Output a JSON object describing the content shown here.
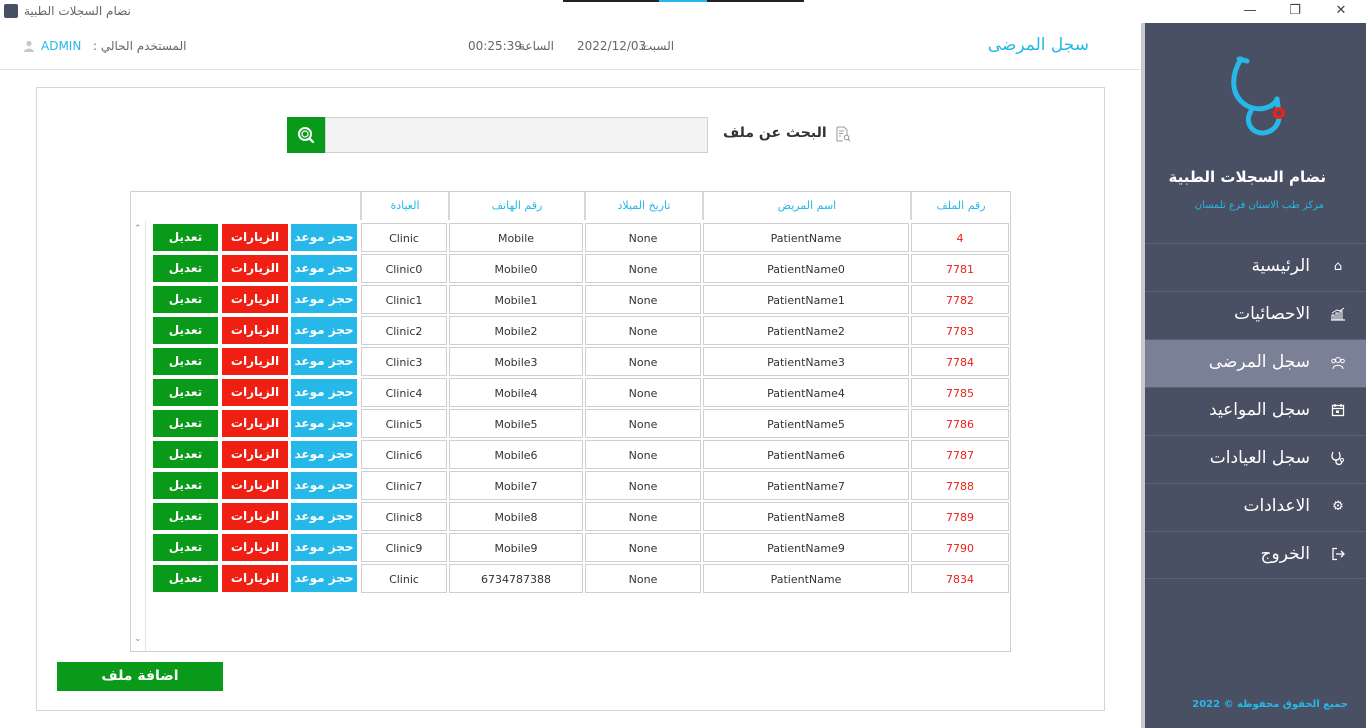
{
  "window": {
    "title": "نضام السجلات الطبية",
    "minimize": "—",
    "restore": "❐",
    "close": "✕"
  },
  "header": {
    "page_title": "سجل المرضى",
    "day": "السبت",
    "date": "2022/12/03",
    "time_label": "الساعة",
    "time": "00:25:39",
    "user_label": "المستخدم الحالي :",
    "user_name": "ADMIN"
  },
  "sidebar": {
    "app_name": "نضام السجلات الطبية",
    "app_subtitle": "مركز طب الاسنان فرع تلمسان",
    "items": [
      {
        "label": "الرئيسية",
        "icon": "home-icon",
        "active": false
      },
      {
        "label": "الاحصائيات",
        "icon": "chart-icon",
        "active": false
      },
      {
        "label": "سجل المرضى",
        "icon": "patients-icon",
        "active": true
      },
      {
        "label": "سجل المواعيد",
        "icon": "calendar-icon",
        "active": false
      },
      {
        "label": "سجل العيادات",
        "icon": "stethoscope-icon",
        "active": false
      },
      {
        "label": "الاعدادات",
        "icon": "gear-icon",
        "active": false
      },
      {
        "label": "الخروج",
        "icon": "logout-icon",
        "active": false
      }
    ],
    "copyright": "جميع الحقوق محفوظة © 2022"
  },
  "search": {
    "label": "البحث عن ملف",
    "value": ""
  },
  "table": {
    "headers": {
      "file_no": "رقم الملف",
      "name": "اسم المريض",
      "birth": "تاريخ الميلاد",
      "phone": "رقم الهاتف",
      "clinic": "العيادة"
    },
    "actions": {
      "book": "حجز موعد",
      "visits": "الزيارات",
      "edit": "تعديل"
    },
    "rows": [
      {
        "file_no": "4",
        "name": "PatientName",
        "birth": "None",
        "phone": "Mobile",
        "clinic": "Clinic"
      },
      {
        "file_no": "7781",
        "name": "PatientName0",
        "birth": "None",
        "phone": "Mobile0",
        "clinic": "Clinic0"
      },
      {
        "file_no": "7782",
        "name": "PatientName1",
        "birth": "None",
        "phone": "Mobile1",
        "clinic": "Clinic1"
      },
      {
        "file_no": "7783",
        "name": "PatientName2",
        "birth": "None",
        "phone": "Mobile2",
        "clinic": "Clinic2"
      },
      {
        "file_no": "7784",
        "name": "PatientName3",
        "birth": "None",
        "phone": "Mobile3",
        "clinic": "Clinic3"
      },
      {
        "file_no": "7785",
        "name": "PatientName4",
        "birth": "None",
        "phone": "Mobile4",
        "clinic": "Clinic4"
      },
      {
        "file_no": "7786",
        "name": "PatientName5",
        "birth": "None",
        "phone": "Mobile5",
        "clinic": "Clinic5"
      },
      {
        "file_no": "7787",
        "name": "PatientName6",
        "birth": "None",
        "phone": "Mobile6",
        "clinic": "Clinic6"
      },
      {
        "file_no": "7788",
        "name": "PatientName7",
        "birth": "None",
        "phone": "Mobile7",
        "clinic": "Clinic7"
      },
      {
        "file_no": "7789",
        "name": "PatientName8",
        "birth": "None",
        "phone": "Mobile8",
        "clinic": "Clinic8"
      },
      {
        "file_no": "7790",
        "name": "PatientName9",
        "birth": "None",
        "phone": "Mobile9",
        "clinic": "Clinic9"
      },
      {
        "file_no": "7834",
        "name": "PatientName",
        "birth": "None",
        "phone": "6734787388",
        "clinic": "Clinic"
      }
    ]
  },
  "add_button": "اضافة ملف",
  "colors": {
    "accent": "#26b8e8",
    "sidebar": "#4a5063",
    "sidebar_active": "#7a8095",
    "green": "#0a9a1a",
    "red": "#f01f14"
  }
}
